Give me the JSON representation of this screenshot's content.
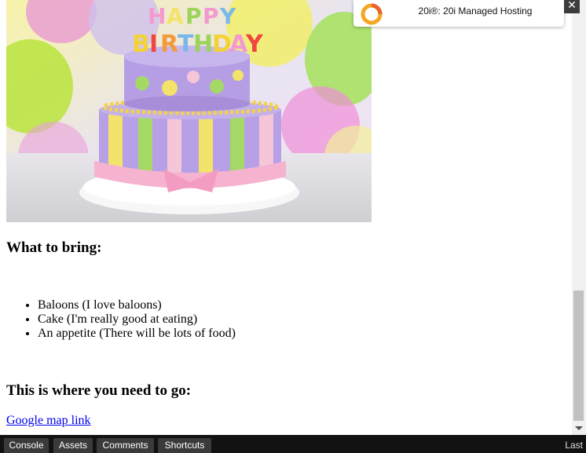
{
  "ad": {
    "text": "20i®: 20i Managed Hosting",
    "close_glyph": "✕",
    "accent": "#f5a623"
  },
  "image": {
    "cake_lettering": "HAPPY BIRTHDAY"
  },
  "sections": {
    "bring_heading": "What to bring:",
    "bring_items": [
      "Baloons (I love baloons)",
      "Cake (I'm really good at eating)",
      "An appetite (There will be lots of food)"
    ],
    "go_heading": "This is where you need to go:",
    "map_link": "Google map link"
  },
  "toolbar": {
    "tabs": [
      "Console",
      "Assets",
      "Comments",
      "Shortcuts"
    ],
    "right_label": "Last"
  }
}
